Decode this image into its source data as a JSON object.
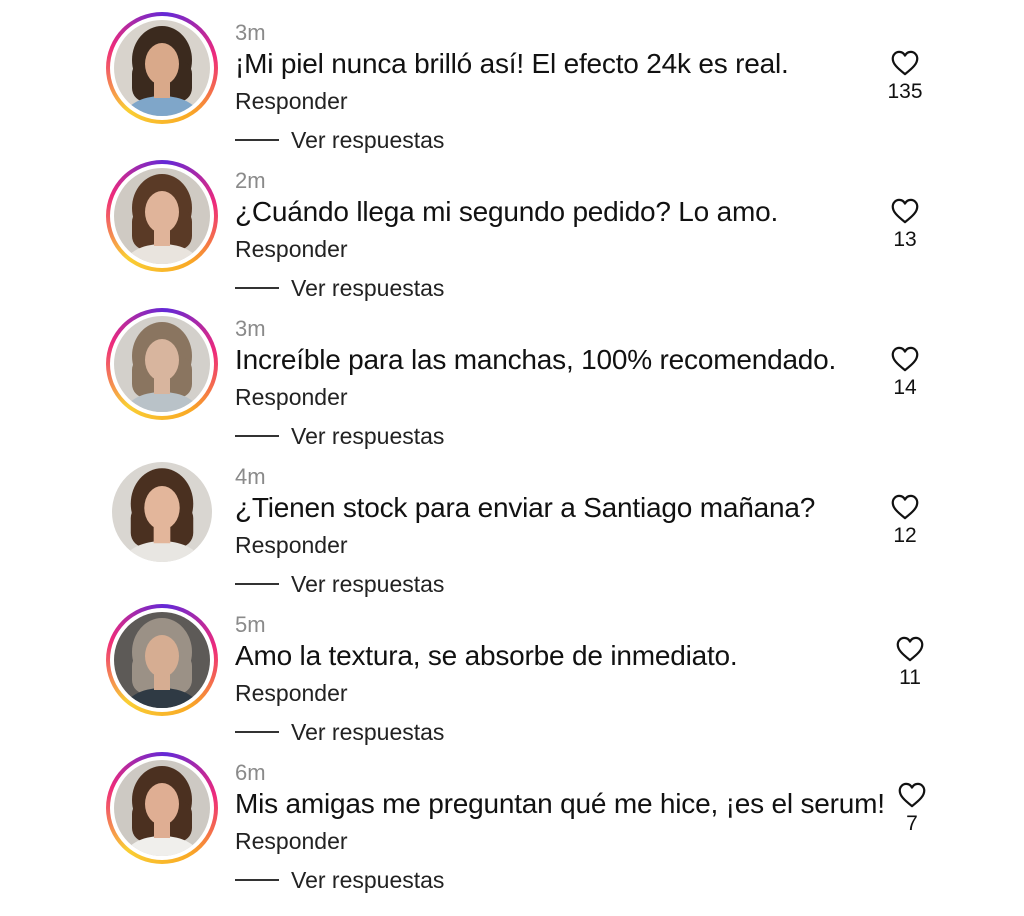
{
  "comments": [
    {
      "time": "3m",
      "text": "¡Mi piel nunca brilló así! El efecto 24k es real.",
      "reply_label": "Responder",
      "view_replies_label": "Ver respuestas",
      "likes": "135",
      "has_story_ring": true,
      "hair_color": "#3b2a1e",
      "skin_color": "#d9a98a",
      "shirt_color": "#7fa6c9"
    },
    {
      "time": "2m",
      "text": "¿Cuándo llega mi segundo pedido? Lo amo.",
      "reply_label": "Responder",
      "view_replies_label": "Ver respuestas",
      "likes": "13",
      "has_story_ring": true,
      "hair_color": "#5a3a26",
      "skin_color": "#e0b49a",
      "shirt_color": "#e9e4de"
    },
    {
      "time": "3m",
      "text": "Increíble para las manchas, 100% recomendado.",
      "reply_label": "Responder",
      "view_replies_label": "Ver respuestas",
      "likes": "14",
      "has_story_ring": true,
      "hair_color": "#8a7560",
      "skin_color": "#d8b59e",
      "shirt_color": "#b9c2c8"
    },
    {
      "time": "4m",
      "text": "¿Tienen stock para enviar a Santiago mañana?",
      "reply_label": "Responder",
      "view_replies_label": "Ver respuestas",
      "likes": "12",
      "has_story_ring": false,
      "hair_color": "#4a3020",
      "skin_color": "#e3b69b",
      "shirt_color": "#e8e6e2"
    },
    {
      "time": "5m",
      "text": "Amo la textura, se absorbe de inmediato.",
      "reply_label": "Responder",
      "view_replies_label": "Ver respuestas",
      "likes": "11",
      "has_story_ring": true,
      "hair_color": "#9b9186",
      "skin_color": "#d6ad92",
      "shirt_color": "#2f3a44"
    },
    {
      "time": "6m",
      "text": "Mis amigas me preguntan qué me hice, ¡es el serum!",
      "reply_label": "Responder",
      "view_replies_label": "Ver respuestas",
      "likes": "7",
      "has_story_ring": true,
      "hair_color": "#4b3020",
      "skin_color": "#dfae93",
      "shirt_color": "#f0efec"
    }
  ]
}
